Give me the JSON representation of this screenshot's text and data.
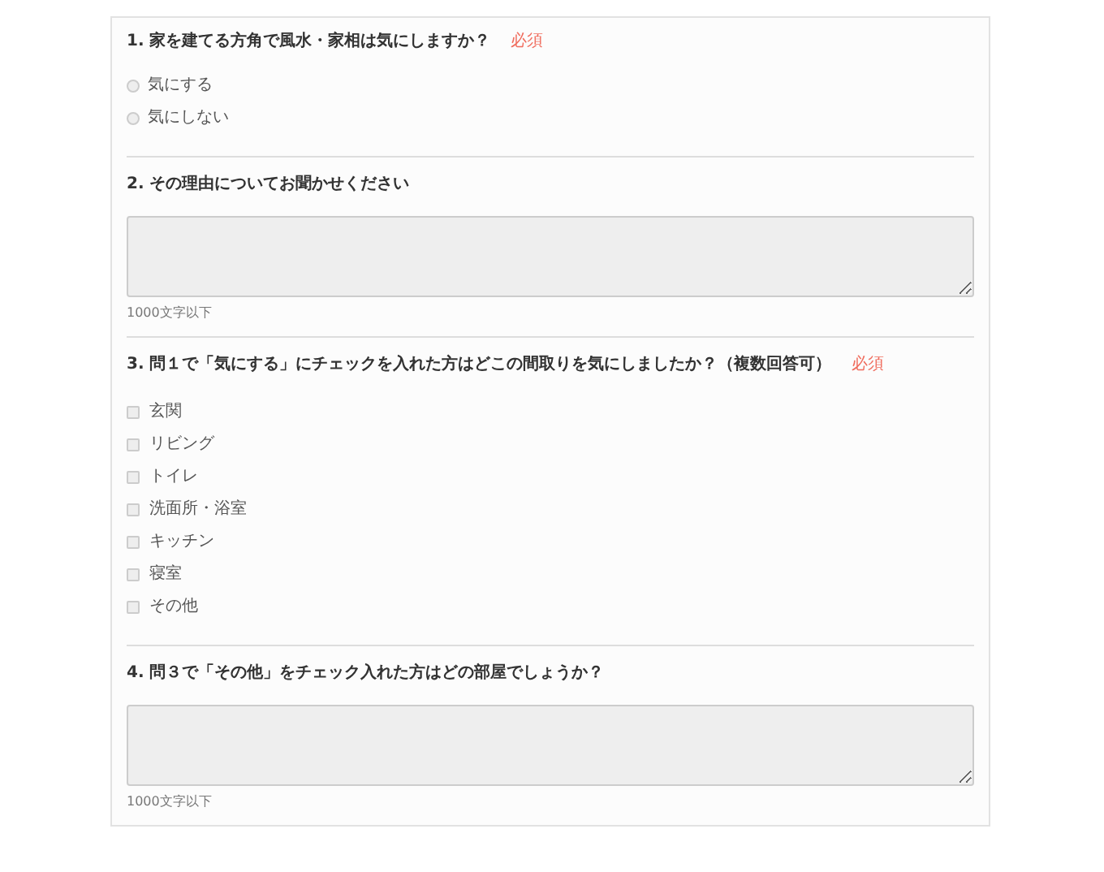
{
  "questions": [
    {
      "kind": "radio",
      "title": "1. 家を建てる方角で風水・家相は気にしますか？",
      "required": "必須",
      "options": [
        {
          "label": "気にする",
          "selected": false
        },
        {
          "label": "気にしない",
          "selected": false
        }
      ]
    },
    {
      "kind": "textarea",
      "title": "2. その理由についてお聞かせください",
      "hint": "1000文字以下"
    },
    {
      "kind": "checkbox",
      "title": "3. 問１で「気にする」にチェックを入れた方はどこの間取りを気にしましたか？（複数回答可）",
      "required": "必須",
      "options": [
        {
          "label": "玄関",
          "checked": false
        },
        {
          "label": "リビング",
          "checked": false
        },
        {
          "label": "トイレ",
          "checked": false
        },
        {
          "label": "洗面所・浴室",
          "checked": false
        },
        {
          "label": "キッチン",
          "checked": false
        },
        {
          "label": "寝室",
          "checked": false
        },
        {
          "label": "その他",
          "checked": false
        }
      ]
    },
    {
      "kind": "textarea",
      "title": "4. 問３で「その他」をチェック入れた方はどの部屋でしょうか？",
      "hint": "1000文字以下"
    }
  ]
}
